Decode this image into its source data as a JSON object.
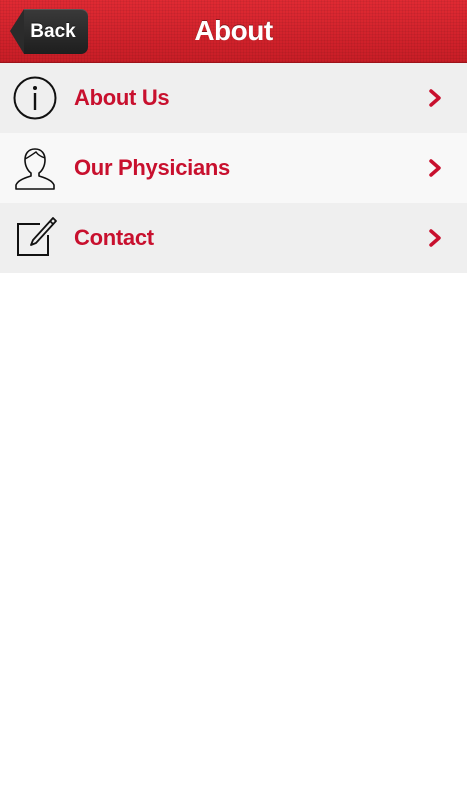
{
  "navbar": {
    "title": "About",
    "back_label": "Back",
    "color": "#d8242d"
  },
  "menu": {
    "items": [
      {
        "label": "About Us",
        "icon": "info-icon"
      },
      {
        "label": "Our Physicians",
        "icon": "person-icon"
      },
      {
        "label": "Contact",
        "icon": "edit-icon"
      }
    ],
    "accent_color": "#c8102e"
  }
}
